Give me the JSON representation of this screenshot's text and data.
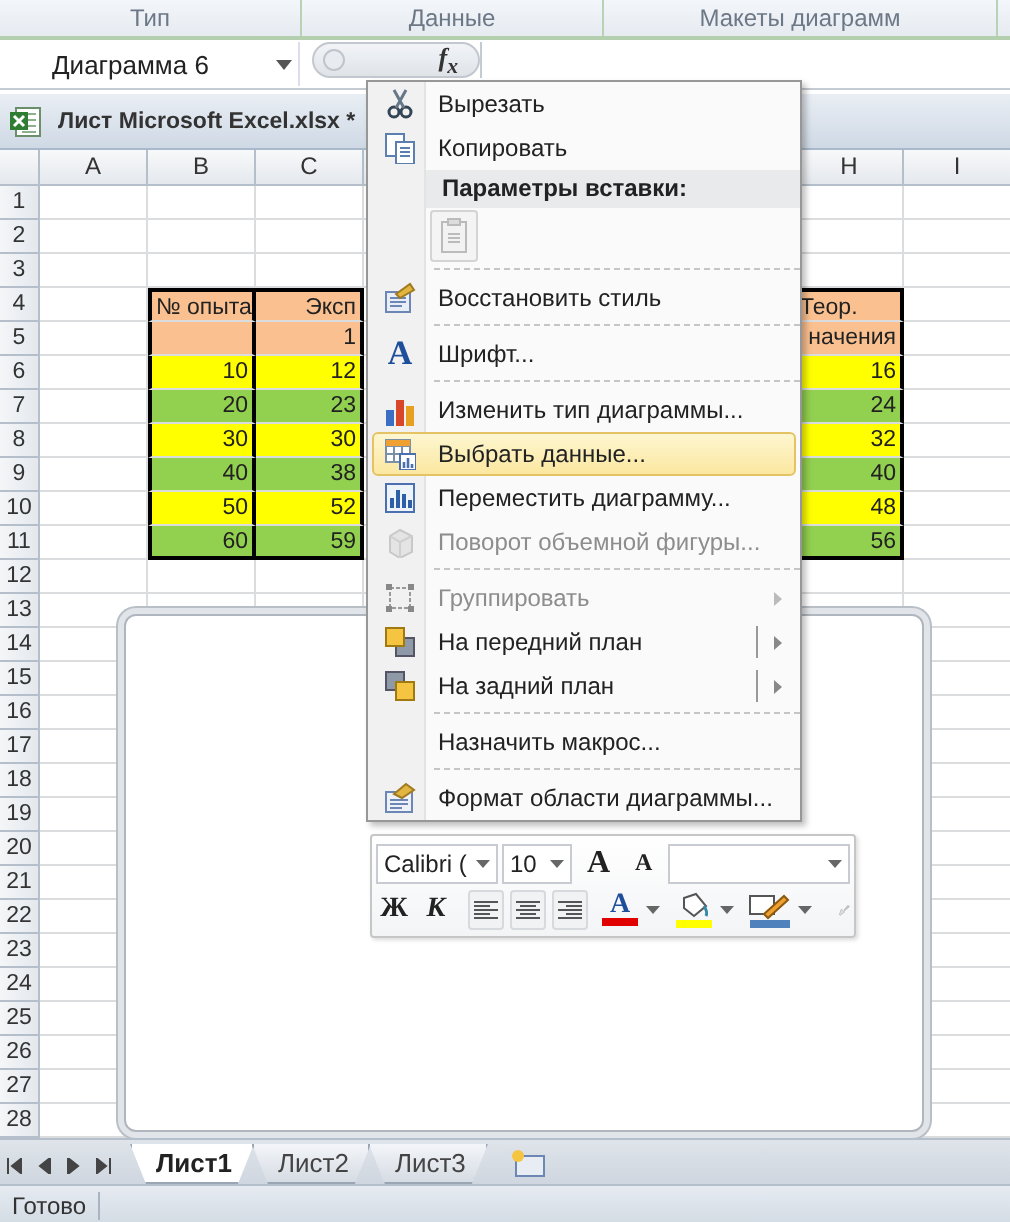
{
  "ribbon": {
    "groups": [
      "Тип",
      "Данные",
      "Макеты диаграмм"
    ]
  },
  "formula_bar": {
    "name_box": "Диаграмма 6",
    "function_button": "f$_{x}$"
  },
  "workbook": {
    "title": "Лист Microsoft Excel.xlsx *"
  },
  "sheet": {
    "columns_left": [
      "A",
      "B",
      "C"
    ],
    "columns_right": [
      "H",
      "I"
    ],
    "rows": [
      {
        "header": "1"
      },
      {
        "header": "2"
      },
      {
        "header": "3"
      },
      {
        "header": "4",
        "color": "#fac090",
        "cells_left": [
          {
            "kind": "left",
            "text": "№ опыта"
          },
          {
            "kind": "right",
            "text": "Эксп"
          }
        ],
        "cells_right": [
          {
            "kind": "left",
            "text": "Теор."
          }
        ]
      },
      {
        "header": "5",
        "color": "#fac090",
        "cells_left": [
          {
            "kind": "blank"
          },
          {
            "kind": "right",
            "text": "1"
          }
        ],
        "cells_right": [
          {
            "kind": "right",
            "text": "начения"
          }
        ]
      },
      {
        "header": "6",
        "color": "#ffff00",
        "cells_left": [
          {
            "kind": "right",
            "text": "10"
          },
          {
            "kind": "right",
            "text": "12"
          }
        ],
        "cells_right": [
          {
            "kind": "right",
            "text": "16"
          }
        ]
      },
      {
        "header": "7",
        "color": "#92d050",
        "cells_left": [
          {
            "kind": "right",
            "text": "20"
          },
          {
            "kind": "right",
            "text": "23"
          }
        ],
        "cells_right": [
          {
            "kind": "right",
            "text": "24"
          }
        ]
      },
      {
        "header": "8",
        "color": "#ffff00",
        "cells_left": [
          {
            "kind": "right",
            "text": "30"
          },
          {
            "kind": "right",
            "text": "30"
          }
        ],
        "cells_right": [
          {
            "kind": "right",
            "text": "32"
          }
        ]
      },
      {
        "header": "9",
        "color": "#92d050",
        "cells_left": [
          {
            "kind": "right",
            "text": "40"
          },
          {
            "kind": "right",
            "text": "38"
          }
        ],
        "cells_right": [
          {
            "kind": "right",
            "text": "40"
          }
        ]
      },
      {
        "header": "10",
        "color": "#ffff00",
        "cells_left": [
          {
            "kind": "right",
            "text": "50"
          },
          {
            "kind": "right",
            "text": "52"
          }
        ],
        "cells_right": [
          {
            "kind": "right",
            "text": "48"
          }
        ]
      },
      {
        "header": "11",
        "color": "#92d050",
        "cells_left": [
          {
            "kind": "right",
            "text": "60"
          },
          {
            "kind": "right",
            "text": "59"
          }
        ],
        "cells_right": [
          {
            "kind": "right",
            "text": "56"
          }
        ]
      },
      {
        "header": "12"
      },
      {
        "header": "13"
      },
      {
        "header": "14"
      },
      {
        "header": "15"
      },
      {
        "header": "16"
      },
      {
        "header": "17"
      },
      {
        "header": "18"
      },
      {
        "header": "19"
      },
      {
        "header": "20"
      },
      {
        "header": "21"
      },
      {
        "header": "22"
      },
      {
        "header": "23"
      },
      {
        "header": "24"
      },
      {
        "header": "25"
      },
      {
        "header": "26"
      },
      {
        "header": "27"
      },
      {
        "header": "28"
      }
    ],
    "chart_area": {
      "selected": true
    }
  },
  "context_menu": {
    "items": [
      {
        "kind": "item",
        "label": "Вырезать",
        "selected": false,
        "disabled": false,
        "submenu": false
      },
      {
        "kind": "item",
        "label": "Копировать",
        "selected": false,
        "disabled": false,
        "submenu": false
      },
      {
        "kind": "header",
        "label": "Параметры вставки:"
      },
      {
        "kind": "paste-options"
      },
      {
        "kind": "separator"
      },
      {
        "kind": "item",
        "label": "Восстановить стиль",
        "selected": false,
        "disabled": false,
        "submenu": false
      },
      {
        "kind": "separator"
      },
      {
        "kind": "item",
        "label": "Шрифт...",
        "glyph": "A",
        "selected": false,
        "disabled": false,
        "submenu": false
      },
      {
        "kind": "separator"
      },
      {
        "kind": "item",
        "label": "Изменить тип диаграммы...",
        "selected": false,
        "disabled": false,
        "submenu": false
      },
      {
        "kind": "item",
        "label": "Выбрать данные...",
        "selected": true,
        "disabled": false,
        "submenu": false
      },
      {
        "kind": "item",
        "label": "Переместить диаграмму...",
        "selected": false,
        "disabled": false,
        "submenu": false
      },
      {
        "kind": "item",
        "label": "Поворот объемной фигуры...",
        "selected": false,
        "disabled": true,
        "submenu": false
      },
      {
        "kind": "separator"
      },
      {
        "kind": "item",
        "label": "Группировать",
        "selected": false,
        "disabled": true,
        "submenu": true
      },
      {
        "kind": "item",
        "label": "На передний план",
        "selected": false,
        "disabled": false,
        "submenu": true
      },
      {
        "kind": "item",
        "label": "На задний план",
        "selected": false,
        "disabled": false,
        "submenu": true
      },
      {
        "kind": "separator"
      },
      {
        "kind": "item",
        "label": "Назначить макрос...",
        "selected": false,
        "disabled": false,
        "submenu": false
      },
      {
        "kind": "separator"
      },
      {
        "kind": "item",
        "label": "Формат области диаграммы...",
        "selected": false,
        "disabled": false,
        "submenu": false
      }
    ]
  },
  "mini_toolbar": {
    "font": "Calibri (",
    "size": "10",
    "grow_font": "A",
    "shrink_font": "A",
    "bold": "Ж",
    "italic": "К",
    "font_color": "A"
  },
  "sheet_tabs": [
    {
      "label": "Лист1",
      "selected": true
    },
    {
      "label": "Лист2",
      "selected": false
    },
    {
      "label": "Лист3",
      "selected": false
    }
  ],
  "status_bar": {
    "text": "Готово"
  }
}
